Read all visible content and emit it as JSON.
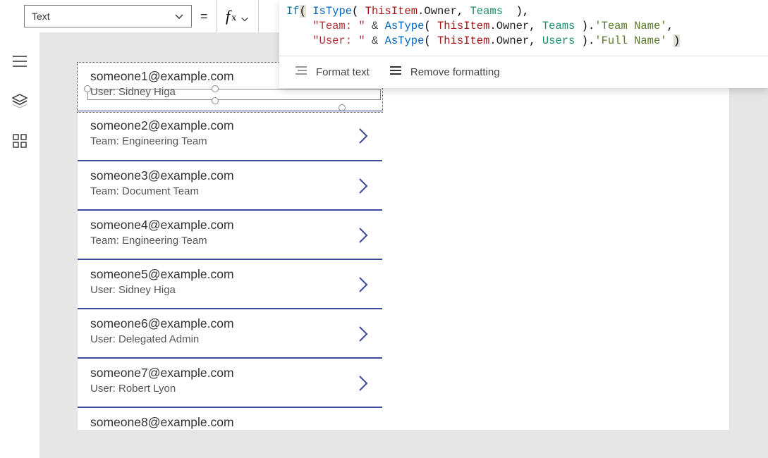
{
  "property_selector": {
    "value": "Text"
  },
  "formula": {
    "tokens": {
      "if": "If",
      "istype": "IsType",
      "astype": "AsType",
      "thisitem": "ThisItem",
      "owner": ".Owner",
      "teams": "Teams",
      "users": "Users",
      "str_team": "\"Team: \"",
      "str_user": "\"User: \"",
      "lit_teamname": "'Team Name'",
      "lit_fullname": "'Full Name'"
    },
    "actions": {
      "format": "Format text",
      "remove": "Remove formatting"
    }
  },
  "gallery": {
    "items": [
      {
        "title": "someone1@example.com",
        "sub": "User: Sidney Higa"
      },
      {
        "title": "someone2@example.com",
        "sub": "Team: Engineering Team"
      },
      {
        "title": "someone3@example.com",
        "sub": "Team: Document Team"
      },
      {
        "title": "someone4@example.com",
        "sub": "Team: Engineering Team"
      },
      {
        "title": "someone5@example.com",
        "sub": "User: Sidney Higa"
      },
      {
        "title": "someone6@example.com",
        "sub": "User: Delegated Admin"
      },
      {
        "title": "someone7@example.com",
        "sub": "User: Robert Lyon"
      },
      {
        "title": "someone8@example.com",
        "sub": ""
      }
    ]
  }
}
